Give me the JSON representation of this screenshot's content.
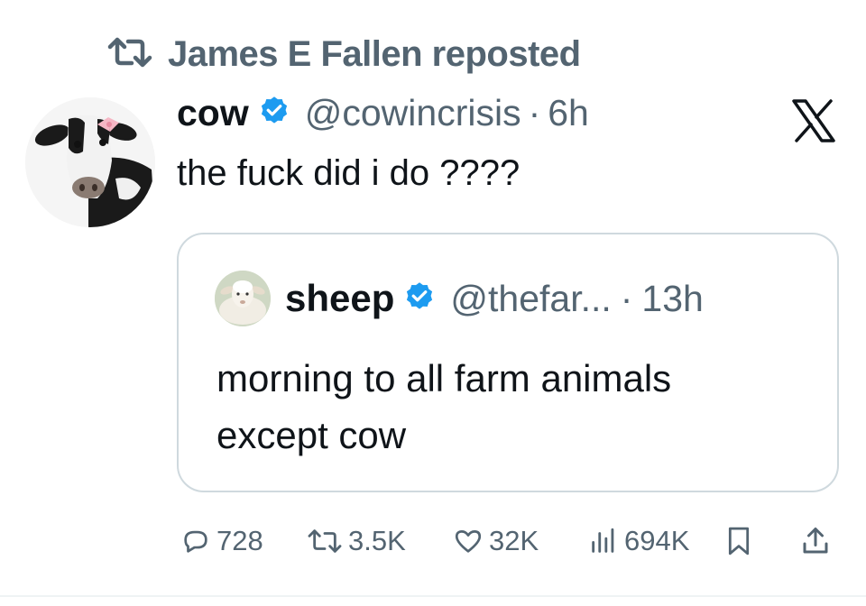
{
  "repost": {
    "label": "James E Fallen reposted",
    "icon": "repost-icon"
  },
  "tweet": {
    "display_name": "cow",
    "verified": true,
    "handle": "@cowincrisis",
    "separator": "·",
    "time": "6h",
    "text": "the fuck did i do ????",
    "avatar": "cow-avatar"
  },
  "quote": {
    "display_name": "sheep",
    "verified": true,
    "handle": "@thefar...",
    "separator": "·",
    "time": "13h",
    "text_lines": [
      "morning to all farm animals",
      "except cow"
    ],
    "avatar": "sheep-avatar"
  },
  "actions": {
    "replies": "728",
    "reposts": "3.5K",
    "likes": "32K",
    "views": "694K"
  },
  "colors": {
    "text": "#0f1419",
    "secondary": "#536471",
    "verified": "#1d9bf0",
    "border": "#cfd9de"
  },
  "icons": [
    "repost-icon",
    "verified-badge-icon",
    "x-logo-icon",
    "reply-icon",
    "retweet-icon",
    "like-icon",
    "views-icon",
    "bookmark-icon",
    "share-icon"
  ]
}
